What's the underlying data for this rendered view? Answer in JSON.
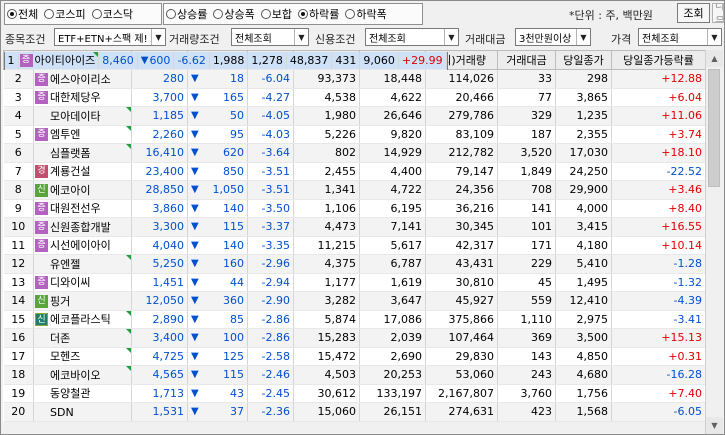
{
  "filter_row1": {
    "market_radios": [
      {
        "label": "전체",
        "checked": true
      },
      {
        "label": "코스피",
        "checked": false
      },
      {
        "label": "코스닥",
        "checked": false
      }
    ],
    "sort_radios": [
      {
        "label": "상승률",
        "checked": false
      },
      {
        "label": "상승폭",
        "checked": false
      },
      {
        "label": "보합",
        "checked": false
      },
      {
        "label": "하락률",
        "checked": true
      },
      {
        "label": "하락폭",
        "checked": false
      }
    ],
    "unit_label": "*단위 : 주, 백만원",
    "query_button": "조회",
    "next_button": "다음"
  },
  "filter_row2": {
    "stock_cond_label": "종목조건",
    "stock_cond_value": "ETF+ETN+스팩 제!",
    "volume_cond_label": "거래량조건",
    "volume_cond_value": "전체조회",
    "credit_cond_label": "신용조건",
    "credit_cond_value": "전체조회",
    "amount_label": "거래대금",
    "amount_value": "3천만원이상",
    "price_label": "가격",
    "price_value": "전체조회"
  },
  "columns": [
    "순위",
    "종목명",
    "현재가",
    "전일대비",
    "등락률",
    "매도잔량",
    "매수잔량",
    "(외)거래량",
    "거래대금",
    "당일종가",
    "당일종가등락률"
  ],
  "rows": [
    {
      "rank": "1",
      "badge": "증",
      "badge_type": "ju",
      "name": "아이티아이즈",
      "flag": true,
      "price": "8,460",
      "diff": "600",
      "rate": "-6.62",
      "ask": "1,988",
      "bid": "1,278",
      "volume": "48,837",
      "amount": "431",
      "close": "9,060",
      "close_rate": "+29.99",
      "close_dir": "pos",
      "selected": true
    },
    {
      "rank": "2",
      "badge": "증",
      "badge_type": "ju",
      "name": "에스아이리소",
      "flag": false,
      "price": "280",
      "diff": "18",
      "rate": "-6.04",
      "ask": "93,373",
      "bid": "18,448",
      "volume": "114,026",
      "amount": "33",
      "close": "298",
      "close_rate": "+12.88",
      "close_dir": "pos"
    },
    {
      "rank": "3",
      "badge": "증",
      "badge_type": "ju",
      "name": "대한제당우",
      "flag": false,
      "price": "3,700",
      "diff": "165",
      "rate": "-4.27",
      "ask": "4,538",
      "bid": "4,622",
      "volume": "20,466",
      "amount": "77",
      "close": "3,865",
      "close_rate": "+6.04",
      "close_dir": "pos"
    },
    {
      "rank": "4",
      "badge": "",
      "badge_type": "",
      "name": "모아데이타",
      "flag": true,
      "price": "1,185",
      "diff": "50",
      "rate": "-4.05",
      "ask": "1,980",
      "bid": "26,646",
      "volume": "279,786",
      "amount": "329",
      "close": "1,235",
      "close_rate": "+11.06",
      "close_dir": "pos"
    },
    {
      "rank": "5",
      "badge": "증",
      "badge_type": "ju",
      "name": "엠투엔",
      "flag": true,
      "price": "2,260",
      "diff": "95",
      "rate": "-4.03",
      "ask": "5,226",
      "bid": "9,820",
      "volume": "83,109",
      "amount": "187",
      "close": "2,355",
      "close_rate": "+3.74",
      "close_dir": "pos"
    },
    {
      "rank": "6",
      "badge": "",
      "badge_type": "",
      "name": "심플랫폼",
      "flag": true,
      "price": "16,410",
      "diff": "620",
      "rate": "-3.64",
      "ask": "802",
      "bid": "14,929",
      "volume": "212,782",
      "amount": "3,520",
      "close": "17,030",
      "close_rate": "+18.10",
      "close_dir": "pos"
    },
    {
      "rank": "7",
      "badge": "경",
      "badge_type": "gyeong",
      "name": "계룡건설",
      "flag": false,
      "price": "23,400",
      "diff": "850",
      "rate": "-3.51",
      "ask": "2,455",
      "bid": "4,400",
      "volume": "79,147",
      "amount": "1,849",
      "close": "24,250",
      "close_rate": "-22.52",
      "close_dir": "neg"
    },
    {
      "rank": "8",
      "badge": "신",
      "badge_type": "sin",
      "name": "에코아이",
      "flag": false,
      "price": "28,850",
      "diff": "1,050",
      "rate": "-3.51",
      "ask": "1,341",
      "bid": "4,722",
      "volume": "24,356",
      "amount": "708",
      "close": "29,900",
      "close_rate": "+3.46",
      "close_dir": "pos"
    },
    {
      "rank": "9",
      "badge": "증",
      "badge_type": "ju",
      "name": "대원전선우",
      "flag": false,
      "price": "3,860",
      "diff": "140",
      "rate": "-3.50",
      "ask": "1,106",
      "bid": "6,195",
      "volume": "36,216",
      "amount": "141",
      "close": "4,000",
      "close_rate": "+8.40",
      "close_dir": "pos"
    },
    {
      "rank": "10",
      "badge": "증",
      "badge_type": "ju",
      "name": "신원종합개발",
      "flag": false,
      "price": "3,300",
      "diff": "115",
      "rate": "-3.37",
      "ask": "4,473",
      "bid": "7,141",
      "volume": "30,345",
      "amount": "101",
      "close": "3,415",
      "close_rate": "+16.55",
      "close_dir": "pos"
    },
    {
      "rank": "11",
      "badge": "증",
      "badge_type": "ju",
      "name": "시선에이아이",
      "flag": false,
      "price": "4,040",
      "diff": "140",
      "rate": "-3.35",
      "ask": "11,215",
      "bid": "5,617",
      "volume": "42,317",
      "amount": "171",
      "close": "4,180",
      "close_rate": "+10.14",
      "close_dir": "pos"
    },
    {
      "rank": "12",
      "badge": "",
      "badge_type": "",
      "name": "유엔젤",
      "flag": true,
      "price": "5,250",
      "diff": "160",
      "rate": "-2.96",
      "ask": "4,375",
      "bid": "6,787",
      "volume": "43,431",
      "amount": "229",
      "close": "5,410",
      "close_rate": "-1.28",
      "close_dir": "neg"
    },
    {
      "rank": "13",
      "badge": "증",
      "badge_type": "ju",
      "name": "디와이씨",
      "flag": false,
      "price": "1,451",
      "diff": "44",
      "rate": "-2.94",
      "ask": "1,177",
      "bid": "1,619",
      "volume": "30,810",
      "amount": "45",
      "close": "1,495",
      "close_rate": "-1.32",
      "close_dir": "neg"
    },
    {
      "rank": "14",
      "badge": "신",
      "badge_type": "sin",
      "name": "핑거",
      "flag": false,
      "price": "12,050",
      "diff": "360",
      "rate": "-2.90",
      "ask": "3,282",
      "bid": "3,647",
      "volume": "45,927",
      "amount": "559",
      "close": "12,410",
      "close_rate": "-4.39",
      "close_dir": "neg"
    },
    {
      "rank": "15",
      "badge": "신",
      "badge_type": "sin2",
      "name": "에코플라스틱",
      "flag": true,
      "price": "2,890",
      "diff": "85",
      "rate": "-2.86",
      "ask": "5,874",
      "bid": "17,086",
      "volume": "375,866",
      "amount": "1,110",
      "close": "2,975",
      "close_rate": "-3.41",
      "close_dir": "neg"
    },
    {
      "rank": "16",
      "badge": "",
      "badge_type": "",
      "name": "더존",
      "flag": true,
      "price": "3,400",
      "diff": "100",
      "rate": "-2.86",
      "ask": "15,283",
      "bid": "2,039",
      "volume": "107,464",
      "amount": "369",
      "close": "3,500",
      "close_rate": "+15.13",
      "close_dir": "pos"
    },
    {
      "rank": "17",
      "badge": "",
      "badge_type": "",
      "name": "모헨즈",
      "flag": true,
      "price": "4,725",
      "diff": "125",
      "rate": "-2.58",
      "ask": "15,472",
      "bid": "2,690",
      "volume": "29,830",
      "amount": "143",
      "close": "4,850",
      "close_rate": "+0.31",
      "close_dir": "pos"
    },
    {
      "rank": "18",
      "badge": "",
      "badge_type": "",
      "name": "에코바이오",
      "flag": true,
      "price": "4,565",
      "diff": "115",
      "rate": "-2.46",
      "ask": "4,503",
      "bid": "20,253",
      "volume": "53,060",
      "amount": "243",
      "close": "4,680",
      "close_rate": "-16.28",
      "close_dir": "neg"
    },
    {
      "rank": "19",
      "badge": "",
      "badge_type": "",
      "name": "동양철관",
      "flag": false,
      "price": "1,713",
      "diff": "43",
      "rate": "-2.45",
      "ask": "30,612",
      "bid": "133,197",
      "volume": "2,167,807",
      "amount": "3,760",
      "close": "1,756",
      "close_rate": "+7.40",
      "close_dir": "pos"
    },
    {
      "rank": "20",
      "badge": "",
      "badge_type": "",
      "name": "SDN",
      "flag": false,
      "price": "1,531",
      "diff": "37",
      "rate": "-2.36",
      "ask": "15,060",
      "bid": "26,151",
      "volume": "274,631",
      "amount": "423",
      "close": "1,568",
      "close_rate": "-6.05",
      "close_dir": "neg"
    }
  ],
  "colors": {
    "positive": "#e00000",
    "negative": "#0050d0",
    "selected_row": "#cfe1f6",
    "header_bg": "#ececec"
  }
}
